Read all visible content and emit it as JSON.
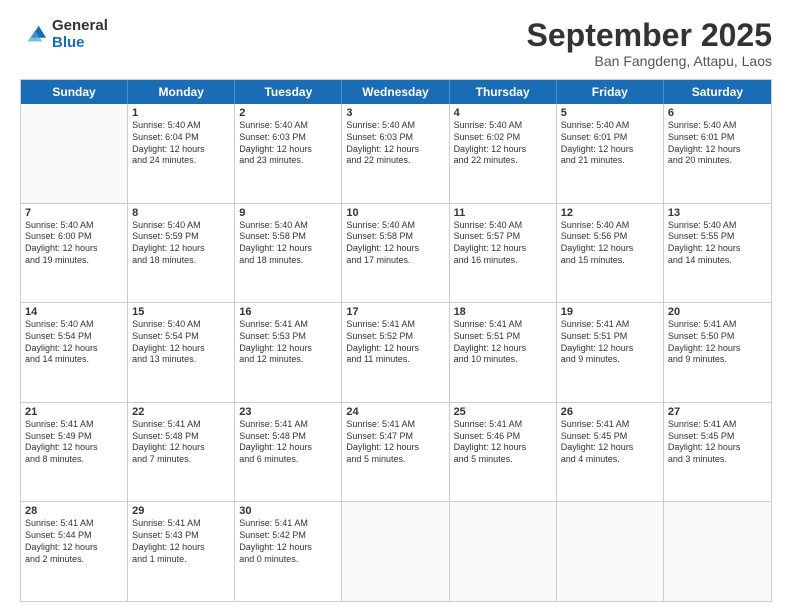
{
  "header": {
    "logo_general": "General",
    "logo_blue": "Blue",
    "month_title": "September 2025",
    "subtitle": "Ban Fangdeng, Attapu, Laos"
  },
  "calendar": {
    "days_of_week": [
      "Sunday",
      "Monday",
      "Tuesday",
      "Wednesday",
      "Thursday",
      "Friday",
      "Saturday"
    ],
    "rows": [
      [
        {
          "day": "",
          "empty": true,
          "lines": []
        },
        {
          "day": "1",
          "lines": [
            "Sunrise: 5:40 AM",
            "Sunset: 6:04 PM",
            "Daylight: 12 hours",
            "and 24 minutes."
          ]
        },
        {
          "day": "2",
          "lines": [
            "Sunrise: 5:40 AM",
            "Sunset: 6:03 PM",
            "Daylight: 12 hours",
            "and 23 minutes."
          ]
        },
        {
          "day": "3",
          "lines": [
            "Sunrise: 5:40 AM",
            "Sunset: 6:03 PM",
            "Daylight: 12 hours",
            "and 22 minutes."
          ]
        },
        {
          "day": "4",
          "lines": [
            "Sunrise: 5:40 AM",
            "Sunset: 6:02 PM",
            "Daylight: 12 hours",
            "and 22 minutes."
          ]
        },
        {
          "day": "5",
          "lines": [
            "Sunrise: 5:40 AM",
            "Sunset: 6:01 PM",
            "Daylight: 12 hours",
            "and 21 minutes."
          ]
        },
        {
          "day": "6",
          "lines": [
            "Sunrise: 5:40 AM",
            "Sunset: 6:01 PM",
            "Daylight: 12 hours",
            "and 20 minutes."
          ]
        }
      ],
      [
        {
          "day": "7",
          "lines": [
            "Sunrise: 5:40 AM",
            "Sunset: 6:00 PM",
            "Daylight: 12 hours",
            "and 19 minutes."
          ]
        },
        {
          "day": "8",
          "lines": [
            "Sunrise: 5:40 AM",
            "Sunset: 5:59 PM",
            "Daylight: 12 hours",
            "and 18 minutes."
          ]
        },
        {
          "day": "9",
          "lines": [
            "Sunrise: 5:40 AM",
            "Sunset: 5:58 PM",
            "Daylight: 12 hours",
            "and 18 minutes."
          ]
        },
        {
          "day": "10",
          "lines": [
            "Sunrise: 5:40 AM",
            "Sunset: 5:58 PM",
            "Daylight: 12 hours",
            "and 17 minutes."
          ]
        },
        {
          "day": "11",
          "lines": [
            "Sunrise: 5:40 AM",
            "Sunset: 5:57 PM",
            "Daylight: 12 hours",
            "and 16 minutes."
          ]
        },
        {
          "day": "12",
          "lines": [
            "Sunrise: 5:40 AM",
            "Sunset: 5:56 PM",
            "Daylight: 12 hours",
            "and 15 minutes."
          ]
        },
        {
          "day": "13",
          "lines": [
            "Sunrise: 5:40 AM",
            "Sunset: 5:55 PM",
            "Daylight: 12 hours",
            "and 14 minutes."
          ]
        }
      ],
      [
        {
          "day": "14",
          "lines": [
            "Sunrise: 5:40 AM",
            "Sunset: 5:54 PM",
            "Daylight: 12 hours",
            "and 14 minutes."
          ]
        },
        {
          "day": "15",
          "lines": [
            "Sunrise: 5:40 AM",
            "Sunset: 5:54 PM",
            "Daylight: 12 hours",
            "and 13 minutes."
          ]
        },
        {
          "day": "16",
          "lines": [
            "Sunrise: 5:41 AM",
            "Sunset: 5:53 PM",
            "Daylight: 12 hours",
            "and 12 minutes."
          ]
        },
        {
          "day": "17",
          "lines": [
            "Sunrise: 5:41 AM",
            "Sunset: 5:52 PM",
            "Daylight: 12 hours",
            "and 11 minutes."
          ]
        },
        {
          "day": "18",
          "lines": [
            "Sunrise: 5:41 AM",
            "Sunset: 5:51 PM",
            "Daylight: 12 hours",
            "and 10 minutes."
          ]
        },
        {
          "day": "19",
          "lines": [
            "Sunrise: 5:41 AM",
            "Sunset: 5:51 PM",
            "Daylight: 12 hours",
            "and 9 minutes."
          ]
        },
        {
          "day": "20",
          "lines": [
            "Sunrise: 5:41 AM",
            "Sunset: 5:50 PM",
            "Daylight: 12 hours",
            "and 9 minutes."
          ]
        }
      ],
      [
        {
          "day": "21",
          "lines": [
            "Sunrise: 5:41 AM",
            "Sunset: 5:49 PM",
            "Daylight: 12 hours",
            "and 8 minutes."
          ]
        },
        {
          "day": "22",
          "lines": [
            "Sunrise: 5:41 AM",
            "Sunset: 5:48 PM",
            "Daylight: 12 hours",
            "and 7 minutes."
          ]
        },
        {
          "day": "23",
          "lines": [
            "Sunrise: 5:41 AM",
            "Sunset: 5:48 PM",
            "Daylight: 12 hours",
            "and 6 minutes."
          ]
        },
        {
          "day": "24",
          "lines": [
            "Sunrise: 5:41 AM",
            "Sunset: 5:47 PM",
            "Daylight: 12 hours",
            "and 5 minutes."
          ]
        },
        {
          "day": "25",
          "lines": [
            "Sunrise: 5:41 AM",
            "Sunset: 5:46 PM",
            "Daylight: 12 hours",
            "and 5 minutes."
          ]
        },
        {
          "day": "26",
          "lines": [
            "Sunrise: 5:41 AM",
            "Sunset: 5:45 PM",
            "Daylight: 12 hours",
            "and 4 minutes."
          ]
        },
        {
          "day": "27",
          "lines": [
            "Sunrise: 5:41 AM",
            "Sunset: 5:45 PM",
            "Daylight: 12 hours",
            "and 3 minutes."
          ]
        }
      ],
      [
        {
          "day": "28",
          "lines": [
            "Sunrise: 5:41 AM",
            "Sunset: 5:44 PM",
            "Daylight: 12 hours",
            "and 2 minutes."
          ]
        },
        {
          "day": "29",
          "lines": [
            "Sunrise: 5:41 AM",
            "Sunset: 5:43 PM",
            "Daylight: 12 hours",
            "and 1 minute."
          ]
        },
        {
          "day": "30",
          "lines": [
            "Sunrise: 5:41 AM",
            "Sunset: 5:42 PM",
            "Daylight: 12 hours",
            "and 0 minutes."
          ]
        },
        {
          "day": "",
          "empty": true,
          "lines": []
        },
        {
          "day": "",
          "empty": true,
          "lines": []
        },
        {
          "day": "",
          "empty": true,
          "lines": []
        },
        {
          "day": "",
          "empty": true,
          "lines": []
        }
      ]
    ]
  }
}
